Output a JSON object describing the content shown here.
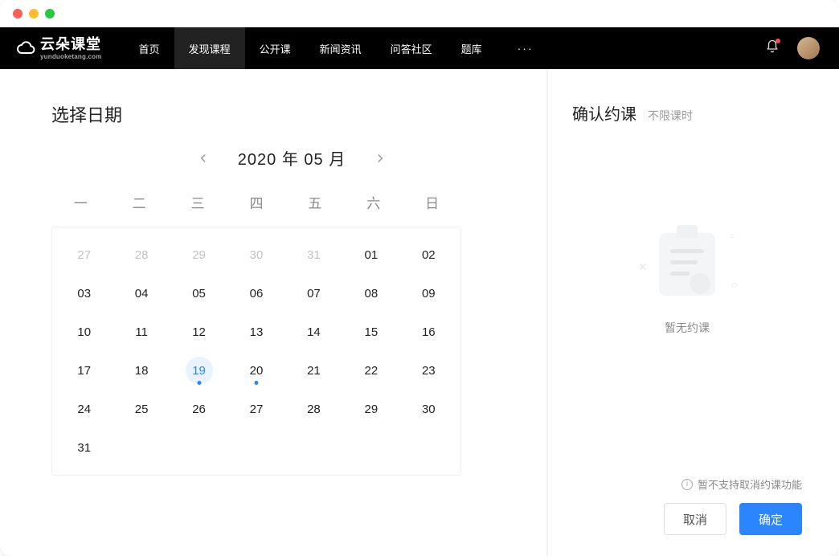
{
  "window": {
    "traffic_lights": [
      "close",
      "minimize",
      "maximize"
    ]
  },
  "branding": {
    "logo_text": "云朵课堂",
    "logo_sub": "yunduoketang.com"
  },
  "nav": {
    "items": [
      {
        "label": "首页",
        "active": false
      },
      {
        "label": "发现课程",
        "active": true
      },
      {
        "label": "公开课",
        "active": false
      },
      {
        "label": "新闻资讯",
        "active": false
      },
      {
        "label": "问答社区",
        "active": false
      },
      {
        "label": "题库",
        "active": false
      }
    ],
    "more_label": "···",
    "bell_has_unread": true
  },
  "calendar": {
    "section_title": "选择日期",
    "header_label": "2020 年 05 月",
    "year": 2020,
    "month": 5,
    "weekdays": [
      "一",
      "二",
      "三",
      "四",
      "五",
      "六",
      "日"
    ],
    "cells": [
      {
        "n": "27",
        "out": true
      },
      {
        "n": "28",
        "out": true
      },
      {
        "n": "29",
        "out": true
      },
      {
        "n": "30",
        "out": true
      },
      {
        "n": "31",
        "out": true
      },
      {
        "n": "01"
      },
      {
        "n": "02"
      },
      {
        "n": "03"
      },
      {
        "n": "04"
      },
      {
        "n": "05"
      },
      {
        "n": "06"
      },
      {
        "n": "07"
      },
      {
        "n": "08"
      },
      {
        "n": "09"
      },
      {
        "n": "10"
      },
      {
        "n": "11"
      },
      {
        "n": "12"
      },
      {
        "n": "13"
      },
      {
        "n": "14"
      },
      {
        "n": "15"
      },
      {
        "n": "16"
      },
      {
        "n": "17"
      },
      {
        "n": "18"
      },
      {
        "n": "19",
        "today": true,
        "dot": true
      },
      {
        "n": "20",
        "dot": true
      },
      {
        "n": "21"
      },
      {
        "n": "22"
      },
      {
        "n": "23"
      },
      {
        "n": "24"
      },
      {
        "n": "25"
      },
      {
        "n": "26"
      },
      {
        "n": "27"
      },
      {
        "n": "28"
      },
      {
        "n": "29"
      },
      {
        "n": "30"
      },
      {
        "n": "31"
      }
    ]
  },
  "booking": {
    "title": "确认约课",
    "subtitle": "不限课时",
    "empty_text": "暂无约课",
    "notice_text": "暂不支持取消约课功能",
    "cancel_label": "取消",
    "confirm_label": "确定"
  },
  "colors": {
    "accent": "#2a85ff"
  }
}
